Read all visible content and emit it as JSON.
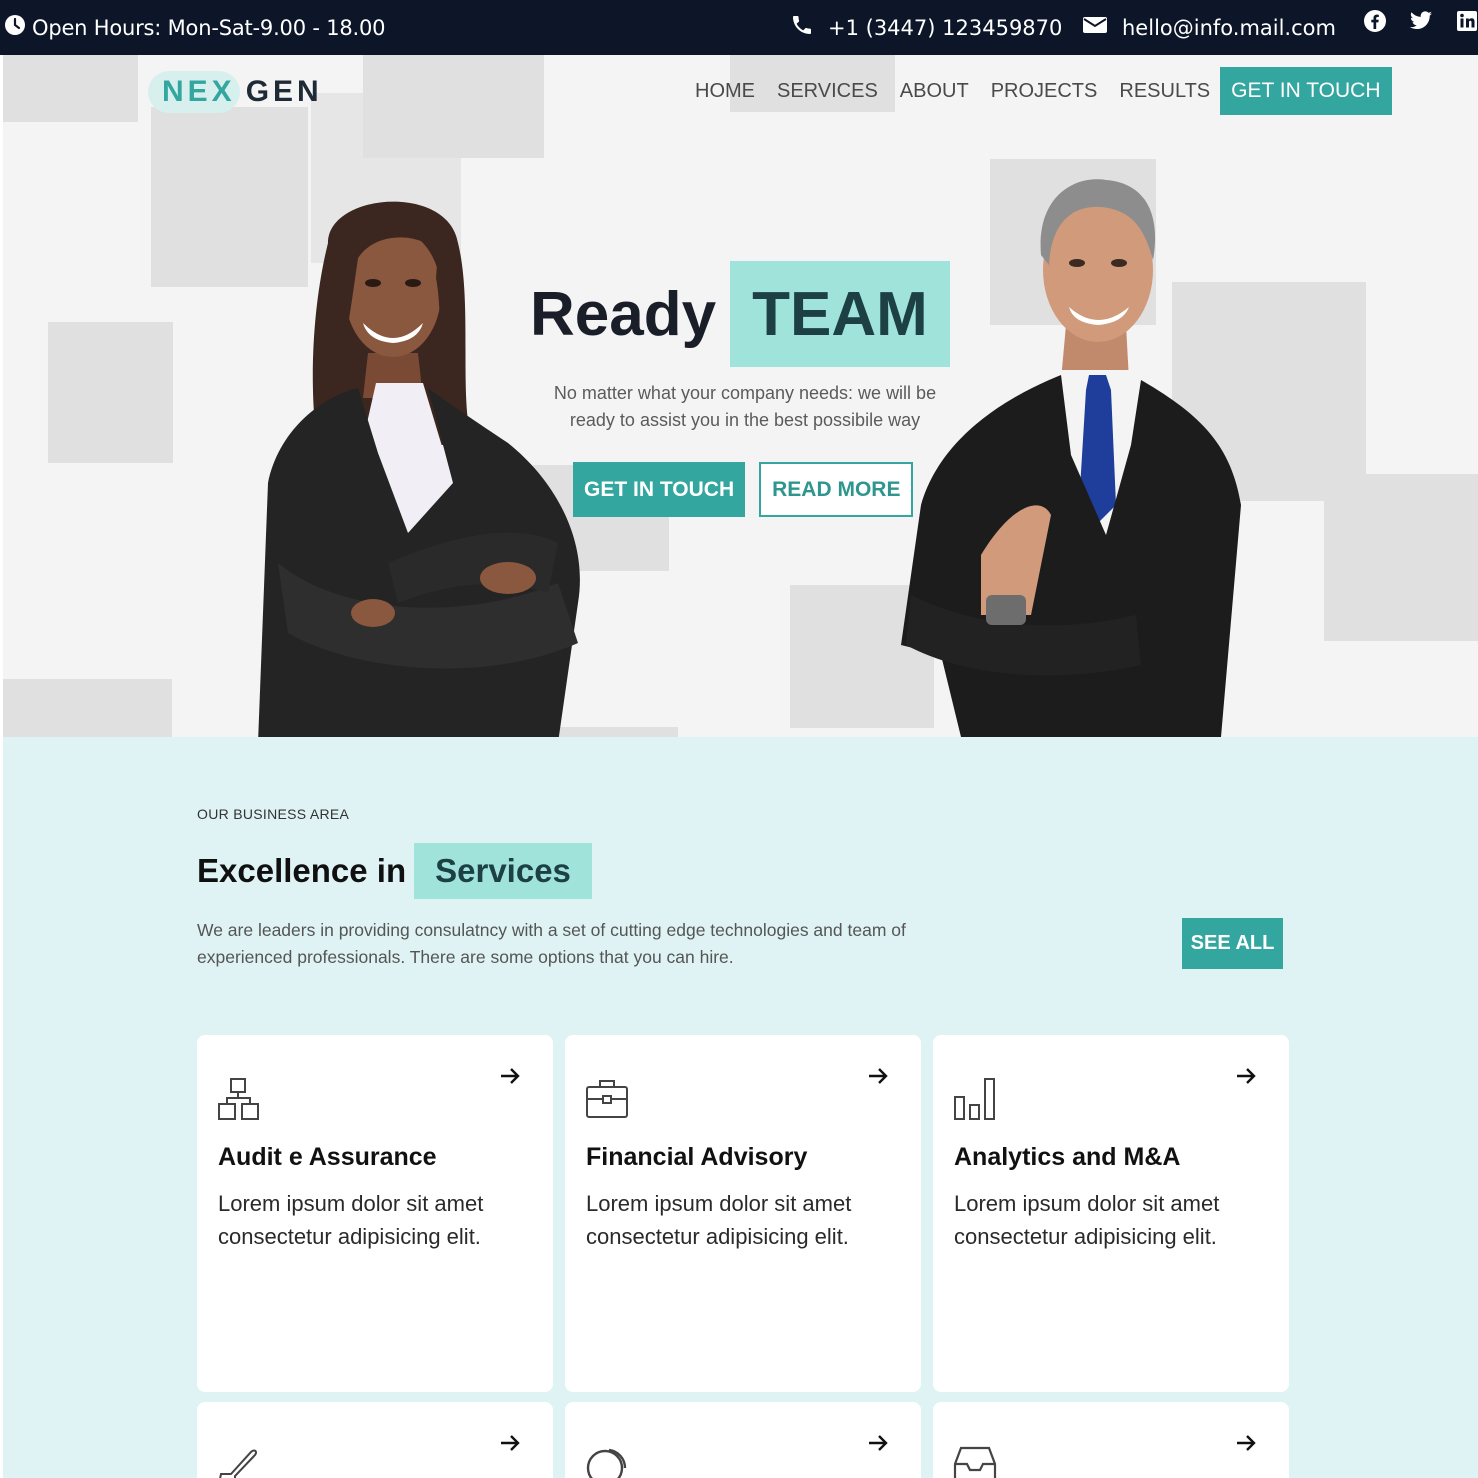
{
  "topbar": {
    "hours": "Open Hours: Mon-Sat-9.00 - 18.00",
    "phone": "+1 (3447) 123459870",
    "email": "hello@info.mail.com",
    "icons": [
      "clock-icon",
      "phone-icon",
      "mail-icon",
      "facebook-icon",
      "twitter-icon",
      "linkedin-icon"
    ]
  },
  "logo": {
    "part1": "NEX",
    "part2": "GEN"
  },
  "nav": {
    "items": [
      "HOME",
      "SERVICES",
      "ABOUT",
      "PROJECTS",
      "RESULTS"
    ],
    "cta": "GET IN TOUCH"
  },
  "hero": {
    "title_plain": "Ready",
    "title_highlight": "TEAM",
    "subtitle": "No matter what your company needs: we will be ready to assist you in the best possibile way",
    "primary_button": "GET IN TOUCH",
    "secondary_button": "READ MORE"
  },
  "services": {
    "eyebrow": "OUR BUSINESS AREA",
    "title_plain": "Excellence in",
    "title_highlight": "Services",
    "description": "We are leaders in providing consulatncy with a set of cutting edge technologies and team of experienced professionals. There are some options that you can hire.",
    "see_all": "SEE ALL",
    "cards": [
      {
        "title": "Audit e Assurance",
        "text": "Lorem ipsum dolor sit amet consectetur adipisicing elit.",
        "icon": "sitemap-icon"
      },
      {
        "title": "Financial Advisory",
        "text": "Lorem ipsum dolor sit amet consectetur adipisicing elit.",
        "icon": "briefcase-icon"
      },
      {
        "title": "Analytics and M&A",
        "text": "Lorem ipsum dolor sit amet consectetur adipisicing elit.",
        "icon": "bar-chart-icon"
      },
      {
        "title": "",
        "text": "",
        "icon": "plane-icon"
      },
      {
        "title": "",
        "text": "",
        "icon": "circle-icon"
      },
      {
        "title": "",
        "text": "",
        "icon": "inbox-icon"
      }
    ]
  },
  "colors": {
    "accent": "#34a6a0",
    "highlight": "#9fe3da",
    "topbar_bg": "#0d1628",
    "section_bg": "#dff3f4",
    "hero_bg": "#f4f4f4"
  }
}
